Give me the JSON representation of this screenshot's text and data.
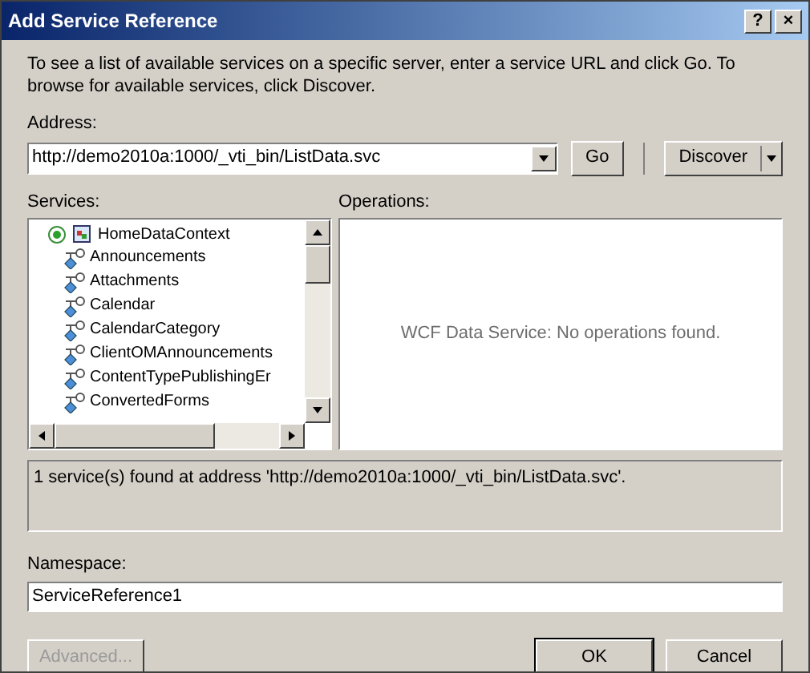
{
  "window": {
    "title": "Add Service Reference",
    "title_buttons": [
      "?",
      "×"
    ]
  },
  "description": "To see a list of available services on a specific server, enter a service URL and click Go. To browse for available services, click Discover.",
  "address": {
    "label": "Address:",
    "value": "http://demo2010a:1000/_vti_bin/ListData.svc"
  },
  "go_button": "Go",
  "discover_button": "Discover",
  "services": {
    "label": "Services:",
    "tree": [
      {
        "label": "HomeDataContext",
        "expanded": true,
        "children": [
          {
            "label": "Announcements"
          },
          {
            "label": "Attachments"
          },
          {
            "label": "Calendar"
          },
          {
            "label": "CalendarCategory"
          },
          {
            "label": "ClientOMAnnouncements"
          },
          {
            "label": "ContentTypePublishingEr"
          },
          {
            "label": "ConvertedForms"
          }
        ]
      }
    ]
  },
  "operations": {
    "label": "Operations:",
    "message": "WCF Data Service: No operations found."
  },
  "status": "1 service(s) found at address 'http://demo2010a:1000/_vti_bin/ListData.svc'.",
  "namespace": {
    "label": "Namespace:",
    "value": "ServiceReference1"
  },
  "buttons": [
    {
      "label": "Advanced...",
      "disabled": true
    },
    {
      "label": "OK",
      "disabled": false
    },
    {
      "label": "Cancel",
      "disabled": false
    }
  ]
}
